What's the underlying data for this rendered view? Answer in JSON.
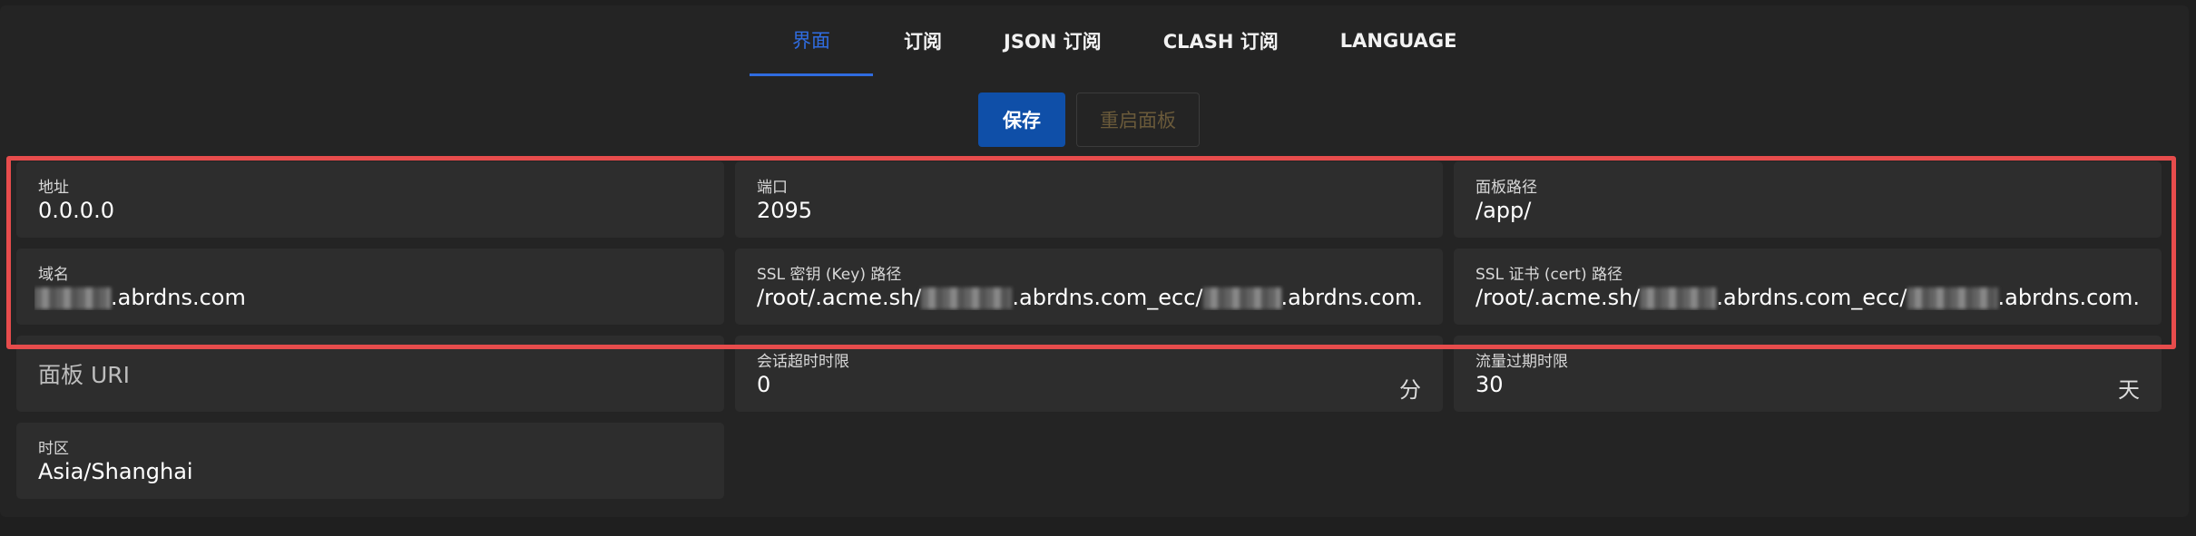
{
  "tabs": [
    {
      "label": "界面",
      "active": true
    },
    {
      "label": "订阅",
      "active": false
    },
    {
      "label": "JSON 订阅",
      "active": false
    },
    {
      "label": "CLASH 订阅",
      "active": false
    },
    {
      "label": "LANGUAGE",
      "active": false
    }
  ],
  "actions": {
    "save_label": "保存",
    "restart_label": "重启面板"
  },
  "fields": {
    "address": {
      "label": "地址",
      "value": "0.0.0.0"
    },
    "port": {
      "label": "端口",
      "value": "2095"
    },
    "base_path": {
      "label": "面板路径",
      "value": "/app/"
    },
    "domain": {
      "label": "域名",
      "value_suffix": ".abrdns.com"
    },
    "ssl_key": {
      "label": "SSL 密钥 (Key) 路径",
      "value_part1": "/root/.acme.sh/",
      "value_part2": ".abrdns.com_ecc/",
      "value_part3": ".abrdns.com.ke"
    },
    "ssl_cert": {
      "label": "SSL 证书 (cert) 路径",
      "value_part1": "/root/.acme.sh/",
      "value_part2": ".abrdns.com_ecc/",
      "value_part3": ".abrdns.com.ce"
    },
    "panel_uri": {
      "placeholder": "面板 URI"
    },
    "session_timeout": {
      "label": "会话超时时限",
      "value": "0",
      "unit": "分"
    },
    "traffic_expire": {
      "label": "流量过期时限",
      "value": "30",
      "unit": "天"
    },
    "timezone": {
      "label": "时区",
      "value": "Asia/Shanghai"
    }
  },
  "colors": {
    "accent": "#2f6ce0",
    "save_button": "#0f4fa8",
    "highlight": "#e74c4c",
    "background": "#242424",
    "field_background": "#2d2d2d"
  }
}
